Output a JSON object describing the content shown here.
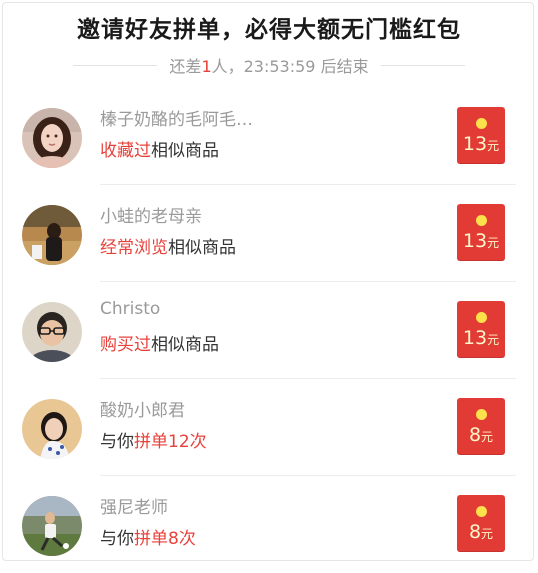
{
  "header": {
    "title": "邀请好友拼单，必得大额无门槛红包",
    "countdown_prefix": "还差",
    "countdown_count": "1",
    "countdown_suffix": "人，23:53:59 后结束"
  },
  "rows": [
    {
      "name": "榛子奶酪的毛阿毛…",
      "desc_red": "收藏过",
      "desc_black": "相似商品",
      "desc_black_prefix": "",
      "amount": "13",
      "unit": "元"
    },
    {
      "name": "小蛙的老母亲",
      "desc_red": "经常浏览",
      "desc_black": "相似商品",
      "desc_black_prefix": "",
      "amount": "13",
      "unit": "元"
    },
    {
      "name": "Christo",
      "desc_red": "购买过",
      "desc_black": "相似商品",
      "desc_black_prefix": "",
      "amount": "13",
      "unit": "元"
    },
    {
      "name": "酸奶小郎君",
      "desc_black_prefix": "与你",
      "desc_red": "拼单12次",
      "desc_black": "",
      "amount": "8",
      "unit": "元"
    },
    {
      "name": "强尼老师",
      "desc_black_prefix": "与你",
      "desc_red": "拼单8次",
      "desc_black": "",
      "amount": "8",
      "unit": "元"
    }
  ]
}
